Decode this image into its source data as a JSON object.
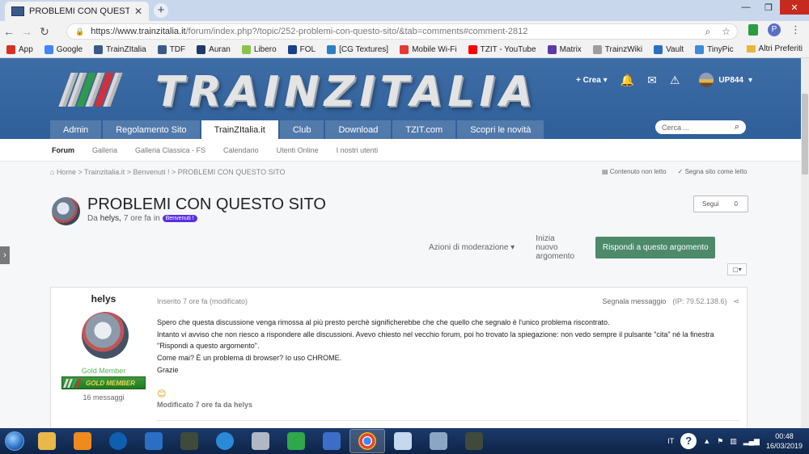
{
  "browser": {
    "tab_title": "PROBLEMI CON QUESTO SITO -",
    "tab_close": "✕",
    "new_tab": "+",
    "url_host": "https://www.trainzitalia.it",
    "url_path": "/forum/index.php?/topic/252-problemi-con-questo-sito/&tab=comments#comment-2812",
    "profile_initial": "P"
  },
  "bookmarks": [
    {
      "label": "App",
      "color": "#d93025"
    },
    {
      "label": "Google",
      "color": "#4285f4"
    },
    {
      "label": "TrainZItalia",
      "color": "#3a5a8a"
    },
    {
      "label": "TDF",
      "color": "#3a5a8a"
    },
    {
      "label": "Auran",
      "color": "#1d3a6a"
    },
    {
      "label": "Libero",
      "color": "#8bc34a"
    },
    {
      "label": "FOL",
      "color": "#1a3f8a"
    },
    {
      "label": "[CG Textures]",
      "color": "#2e7fc0"
    },
    {
      "label": "Mobile Wi-Fi",
      "color": "#e53935"
    },
    {
      "label": "TZIT - YouTube",
      "color": "#ff0000"
    },
    {
      "label": "Matrix",
      "color": "#5b3aa8"
    },
    {
      "label": "TrainzWiki",
      "color": "#9e9e9e"
    },
    {
      "label": "Vault",
      "color": "#2a6fc4"
    },
    {
      "label": "TinyPic",
      "color": "#3c8ad8"
    }
  ],
  "bookmarks_other": "Altri Preferiti",
  "site": {
    "logo_text": "TRAINZITALIA",
    "create_label": "Crea",
    "username": "UP844",
    "nav_tabs": [
      "Admin",
      "Regolamento Sito",
      "TrainZItalia.it",
      "Club",
      "Download",
      "TZIT.com",
      "Scopri le novità"
    ],
    "search_placeholder": "Cerca ...",
    "subnav": [
      "Forum",
      "Galleria",
      "Galleria Classica - FS",
      "Calendario",
      "Utenti Online",
      "I nostri utenti"
    ],
    "breadcrumbs": "Home  >  Trainzitalia.it  >  Benvenuti !  >  PROBLEMI CON QUESTO SITO",
    "unread_content": "Contenuto non letto",
    "mark_read": "Segna sito come letto"
  },
  "topic": {
    "title": "PROBLEMI CON QUESTO SITO",
    "by_prefix": "Da",
    "author": "helys,",
    "time": "7 ore fa",
    "in": "in",
    "forum_badge": "Benvenuti !",
    "follow_label": "Segui",
    "follow_count": "0",
    "moderation_label": "Azioni di moderazione",
    "start_new": "Inizia nuovo argomento",
    "reply_label": "Rispondi a questo argomento"
  },
  "post": {
    "author_name": "helys",
    "group": "Gold Member",
    "rank_badge": "GOLD MEMBER",
    "message_count": "16 messaggi",
    "posted": "Inserito 7 ore fa (modificato)",
    "report": "Segnala messaggio",
    "ip": "(IP: 79.52.138.6)",
    "lines": [
      "Spero che questa discussione venga rimossa al più presto perchè significherebbe che che quello che segnalo è l'unico problema riscontrato.",
      "Intanto vi avviso che non riesco a rispondere alle discussioni. Avevo chiesto nel vecchio forum, poi ho trovato la spiegazione: non vedo sempre il pulsante \"cita\" né la finestra",
      "\"Rispondi a questo argomento\".",
      "Come mai? È un problema di browser? Io uso CHROME.",
      "Grazie"
    ],
    "edited": "Modificato 7 ore fa da helys"
  },
  "taskbar": {
    "lang": "IT",
    "time": "00:48",
    "date": "16/03/2019",
    "apps": [
      {
        "name": "explorer",
        "color": "#e8b84a"
      },
      {
        "name": "media",
        "color": "#f08a1c"
      },
      {
        "name": "hp",
        "color": "#0f5fb0"
      },
      {
        "name": "check",
        "color": "#2a6fc4"
      },
      {
        "name": "train",
        "color": "#3f4a3a"
      },
      {
        "name": "ie",
        "color": "#2b8ad8"
      },
      {
        "name": "search",
        "color": "#b0b8c4"
      },
      {
        "name": "app-green",
        "color": "#2ea84a"
      },
      {
        "name": "feather",
        "color": "#3c6ec8"
      },
      {
        "name": "chrome",
        "color": "#e0463a"
      },
      {
        "name": "docs",
        "color": "#c4d8ee"
      },
      {
        "name": "window",
        "color": "#8aa6c4"
      },
      {
        "name": "train2",
        "color": "#3f4a3a"
      }
    ]
  }
}
